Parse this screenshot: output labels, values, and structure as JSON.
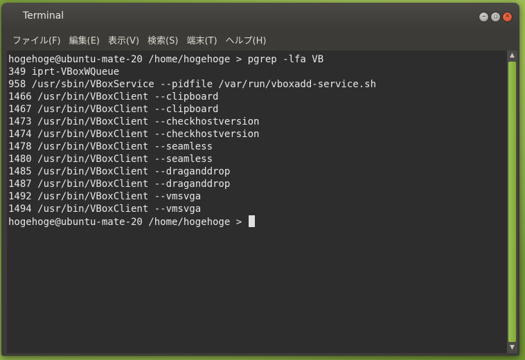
{
  "window": {
    "title": "Terminal",
    "controls": [
      "minimize",
      "maximize",
      "close"
    ]
  },
  "menu": [
    "ファイル(F)",
    "編集(E)",
    "表示(V)",
    "検索(S)",
    "端末(T)",
    "ヘルプ(H)"
  ],
  "terminal": {
    "lines": [
      "hogehoge@ubuntu-mate-20 /home/hogehoge > pgrep -lfa VB",
      "349 iprt-VBoxWQueue",
      "958 /usr/sbin/VBoxService --pidfile /var/run/vboxadd-service.sh",
      "1466 /usr/bin/VBoxClient --clipboard",
      "1467 /usr/bin/VBoxClient --clipboard",
      "1473 /usr/bin/VBoxClient --checkhostversion",
      "1474 /usr/bin/VBoxClient --checkhostversion",
      "1478 /usr/bin/VBoxClient --seamless",
      "1480 /usr/bin/VBoxClient --seamless",
      "1485 /usr/bin/VBoxClient --draganddrop",
      "1487 /usr/bin/VBoxClient --draganddrop",
      "1492 /usr/bin/VBoxClient --vmsvga",
      "1494 /usr/bin/VBoxClient --vmsvga"
    ],
    "prompt": "hogehoge@ubuntu-mate-20 /home/hogehoge > "
  },
  "colors": {
    "accent": "#9ac04c",
    "terminal_bg": "#2d2d2d",
    "terminal_fg": "#e9e9e9",
    "close_button": "#e0532e"
  }
}
